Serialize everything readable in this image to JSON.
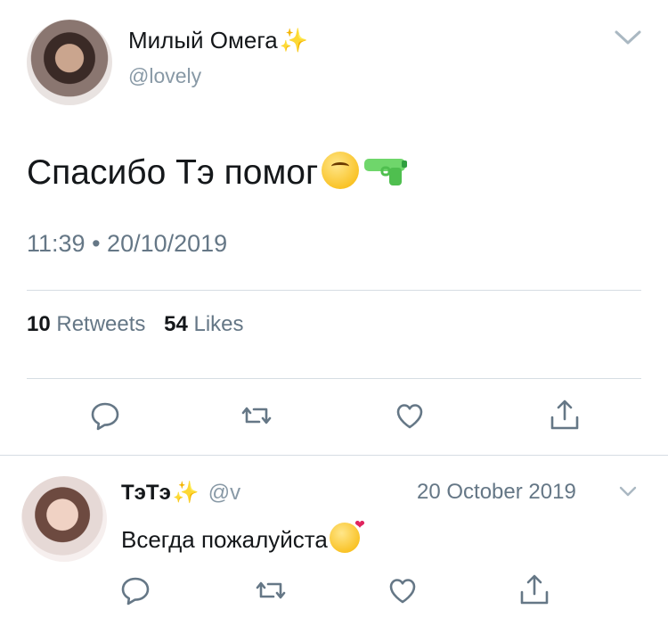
{
  "tweet": {
    "display_name": "Милый Омега",
    "name_emoji": "✨",
    "handle": "@lovely",
    "text": "Спасибо Тэ помог",
    "text_emojis": [
      "upside-down-face-emoji",
      "water-pistol-emoji"
    ],
    "time": "11:39",
    "separator": "•",
    "date": "20/10/2019",
    "stats": {
      "retweets_count": "10",
      "retweets_label": "Retweets",
      "likes_count": "54",
      "likes_label": "Likes"
    },
    "actions": [
      "reply-icon",
      "retweet-icon",
      "like-icon",
      "share-icon"
    ]
  },
  "reply": {
    "display_name": "ТэТэ",
    "name_emoji": "✨",
    "handle": "@v",
    "date": "20 October 2019",
    "text": "Всегда пожалуйста",
    "text_emoji": "smiling-face-with-hearts-emoji",
    "actions": [
      "reply-icon",
      "retweet-icon",
      "like-icon",
      "share-icon"
    ]
  },
  "colors": {
    "text_primary": "#14171a",
    "text_secondary": "#657786",
    "handle_gray": "#8899a6",
    "divider": "#d6dde3",
    "sparkle": "#f5c542",
    "icon_gray": "#657786"
  }
}
